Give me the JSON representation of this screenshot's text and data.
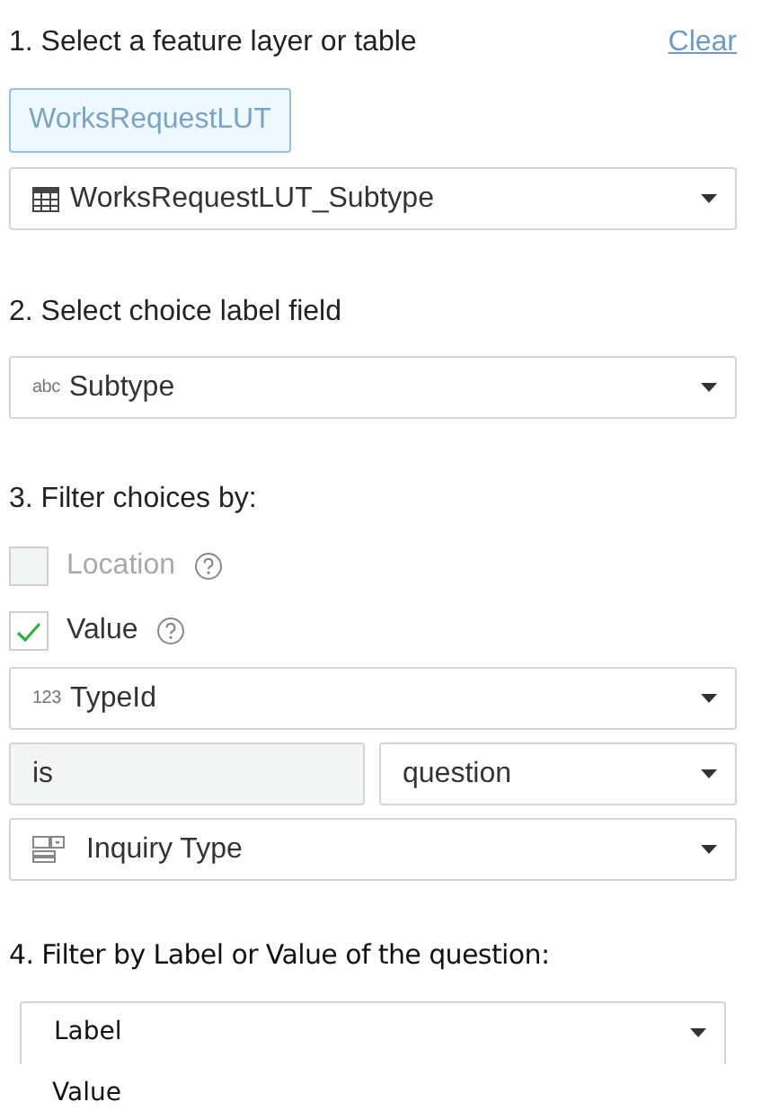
{
  "section1": {
    "heading": "1. Select a feature layer or table",
    "clear_link": "Clear",
    "chip": "WorksRequestLUT",
    "layer_select": {
      "value": "WorksRequestLUT_Subtype"
    }
  },
  "section2": {
    "heading": "2. Select choice label field",
    "field_select": {
      "type_label": "abc",
      "value": "Subtype"
    }
  },
  "section3": {
    "heading": "3. Filter choices by:",
    "options": [
      {
        "label": "Location",
        "checked": false,
        "disabled": true
      },
      {
        "label": "Value",
        "checked": true,
        "disabled": false
      }
    ],
    "value_field_select": {
      "type_label": "123",
      "value": "TypeId"
    },
    "operator": {
      "value": "is"
    },
    "source_select": {
      "value": "question"
    },
    "question_select": {
      "value": "Inquiry Type"
    }
  },
  "section4": {
    "heading": "4. Filter by Label or Value of the question:",
    "filter_select": {
      "value": "Label",
      "options": [
        {
          "label": "Value"
        }
      ]
    }
  }
}
